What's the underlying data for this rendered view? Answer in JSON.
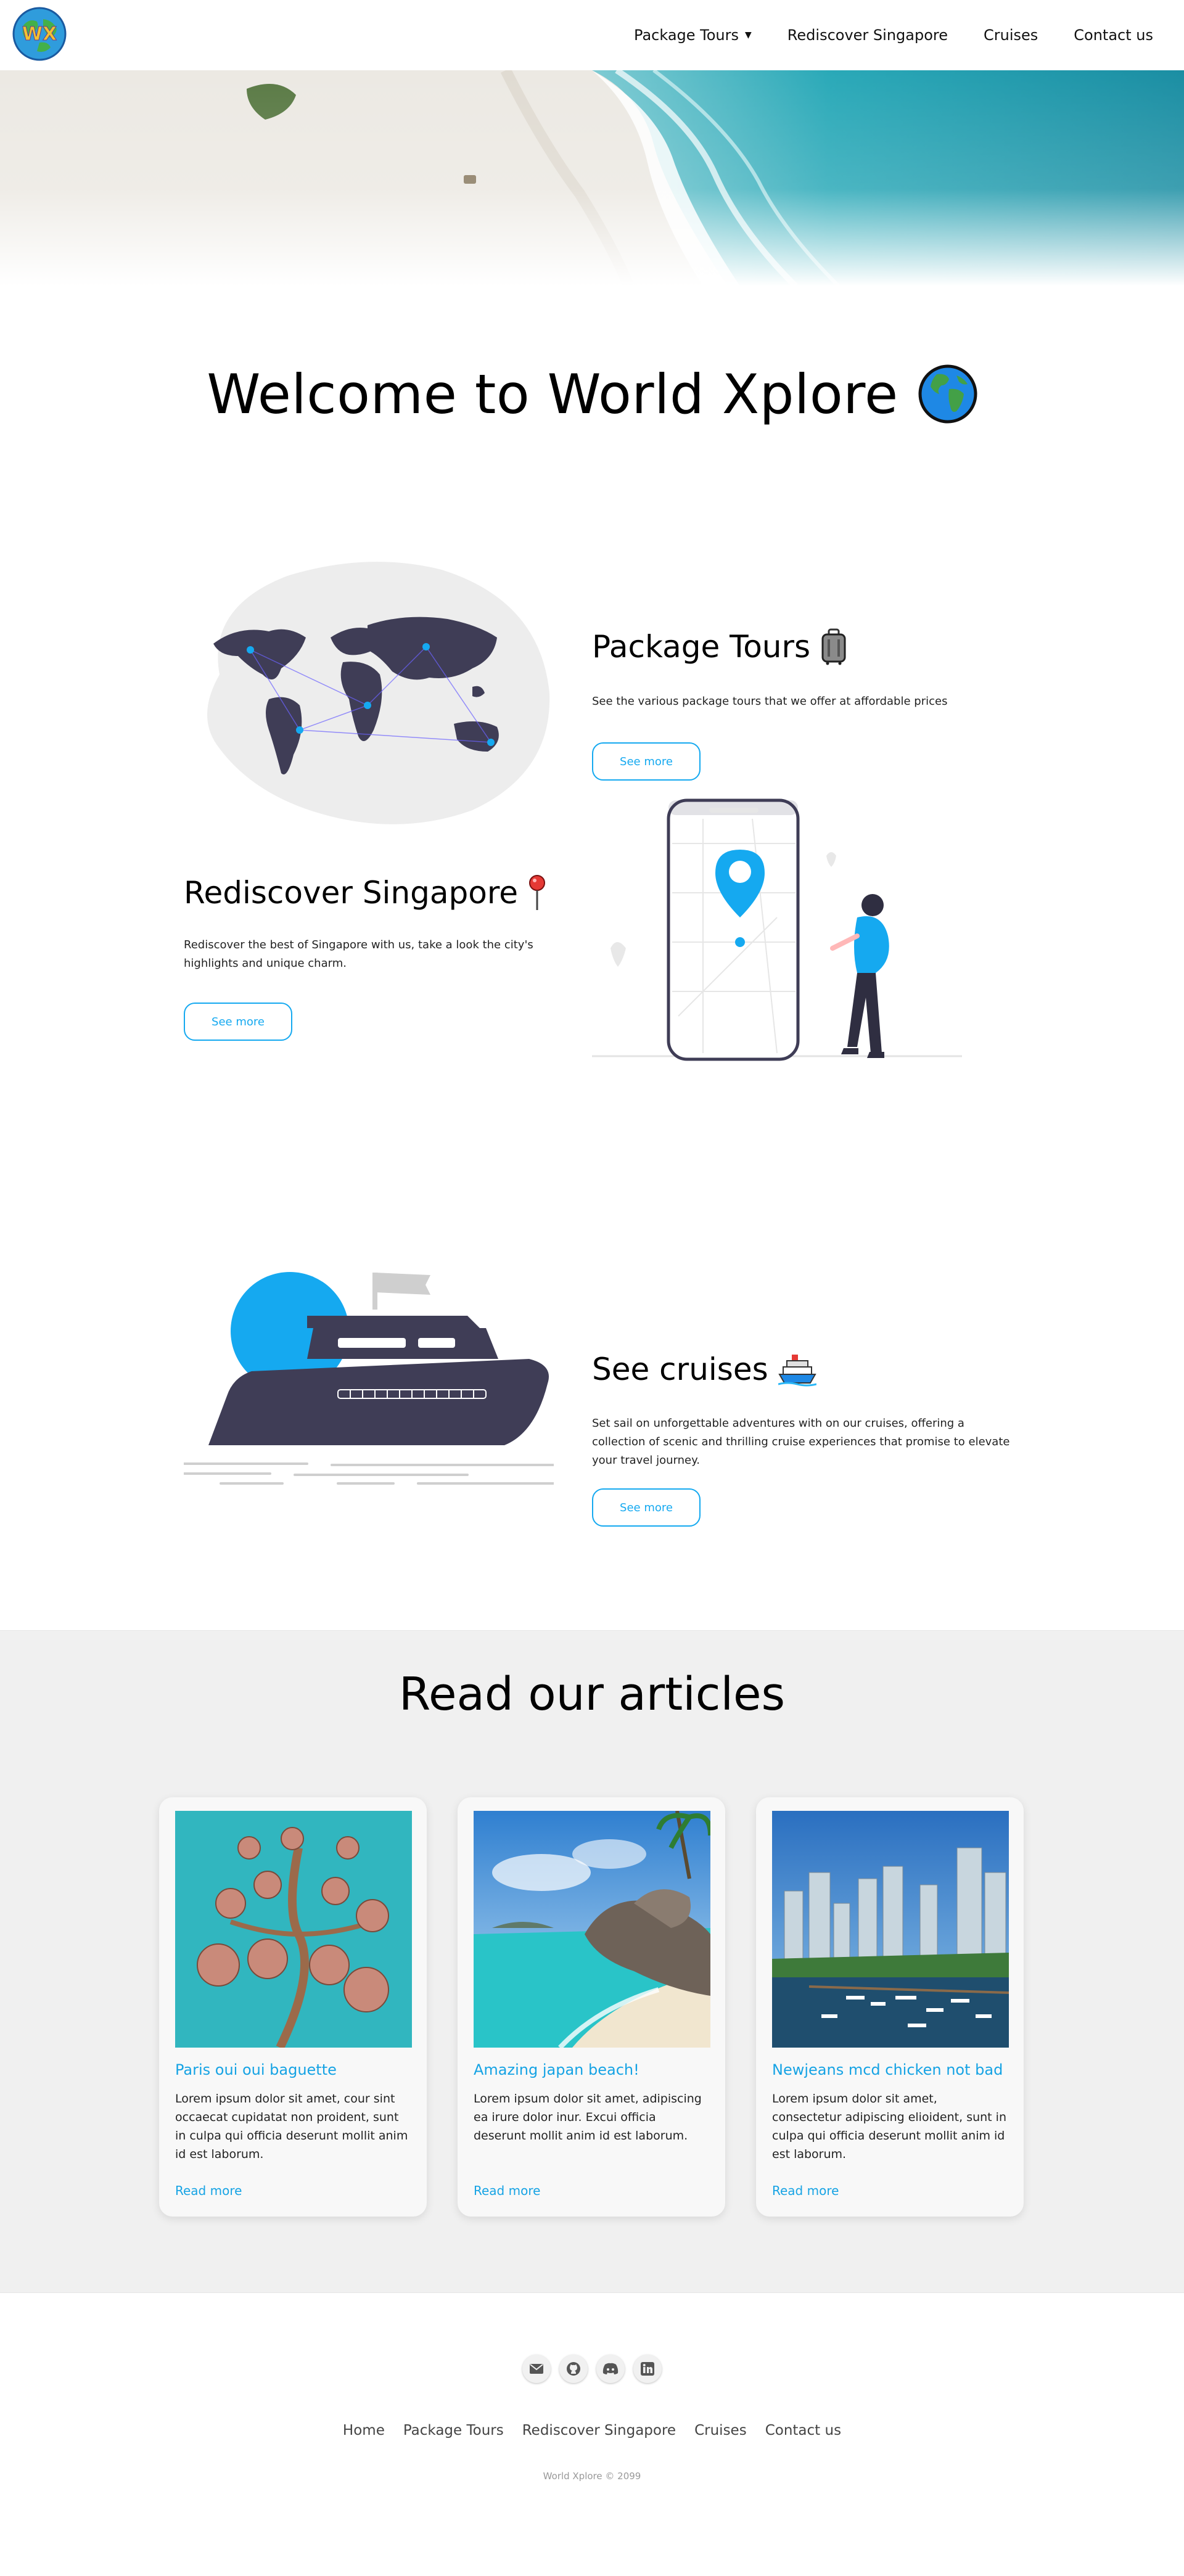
{
  "nav": {
    "logo_text": "WX",
    "links": [
      {
        "label": "Package Tours",
        "dropdown": true
      },
      {
        "label": "Rediscover Singapore"
      },
      {
        "label": "Cruises"
      },
      {
        "label": "Contact us"
      }
    ]
  },
  "welcome": {
    "title": "Welcome to World Xplore",
    "icon": "globe-emoji-icon"
  },
  "features": [
    {
      "title": "Package Tours",
      "icon": "luggage-emoji-icon",
      "description": "See the various package tours that we offer at affordable prices",
      "button": "See more"
    },
    {
      "title": "Rediscover Singapore",
      "icon": "pushpin-emoji-icon",
      "description": "Rediscover the best of Singapore with us, take a look the city's highlights and unique charm.",
      "button": "See more"
    },
    {
      "title": "See cruises",
      "icon": "ship-emoji-icon",
      "description": "Set sail on unforgettable adventures with on our cruises, offering a collection of scenic and thrilling cruise experiences that promise to elevate your travel journey.",
      "button": "See more"
    }
  ],
  "articles": {
    "heading": "Read our articles",
    "cards": [
      {
        "title": "Paris oui oui baguette",
        "body": "Lorem ipsum dolor sit amet, cour sint occaecat cupidatat non proident, sunt in culpa qui officia deserunt mollit anim id est laborum.",
        "link": "Read more"
      },
      {
        "title": "Amazing japan beach!",
        "body": "Lorem ipsum dolor sit amet, adipiscing ea irure dolor inur. Excui officia deserunt mollit anim id est laborum.",
        "link": "Read more"
      },
      {
        "title": "Newjeans mcd chicken not bad",
        "body": "Lorem ipsum dolor sit amet, consectetur adipiscing elioident, sunt in culpa qui officia deserunt mollit anim id est laborum.",
        "link": "Read more"
      }
    ]
  },
  "footer": {
    "socials": [
      "envelope-icon",
      "github-icon",
      "discord-icon",
      "linkedin-icon"
    ],
    "links": [
      "Home",
      "Package Tours",
      "Rediscover Singapore",
      "Cruises",
      "Contact us"
    ],
    "copyright": "World Xplore © 2099"
  },
  "colors": {
    "accent": "#15a9f0",
    "illustration_dark": "#3f3d56",
    "articles_bg": "#f0f0f0"
  }
}
